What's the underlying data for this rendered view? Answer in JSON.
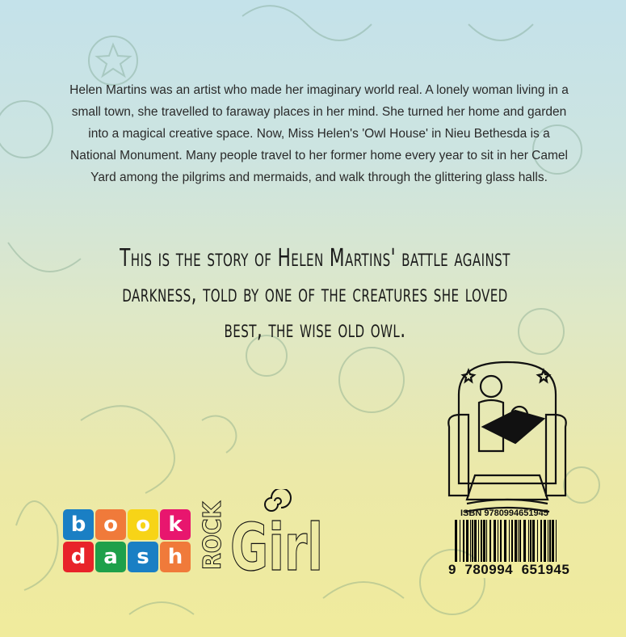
{
  "blurb": "Helen Martins was an artist who made her imaginary world real. A lonely woman living in a small town, she travelled to faraway places in her mind.  She turned her home and garden into a magical creative space. Now, Miss Helen's  'Owl House' in Nieu Bethesda is a National Monument. Many people travel to her former home every year to sit in her Camel Yard among the pilgrims and mermaids, and walk through the glittering glass halls.",
  "tagline": "This is the story of Helen Martins' battle against darkness, told by one of the creatures she loved best, the wise old owl.",
  "logos": {
    "bookdash": {
      "letters": [
        "b",
        "o",
        "o",
        "k",
        "d",
        "a",
        "s",
        "h"
      ],
      "colors": [
        "#1a7fc4",
        "#f07a3a",
        "#f7d417",
        "#e8166e",
        "#e8232a",
        "#1ea04a",
        "#1a7fc4",
        "#f07a3a"
      ]
    },
    "rockgirl": {
      "rock": "ROCK",
      "girl": "Girl"
    }
  },
  "isbn": {
    "label": "ISBN 9780994651945",
    "digits": "9  780994  651945"
  }
}
